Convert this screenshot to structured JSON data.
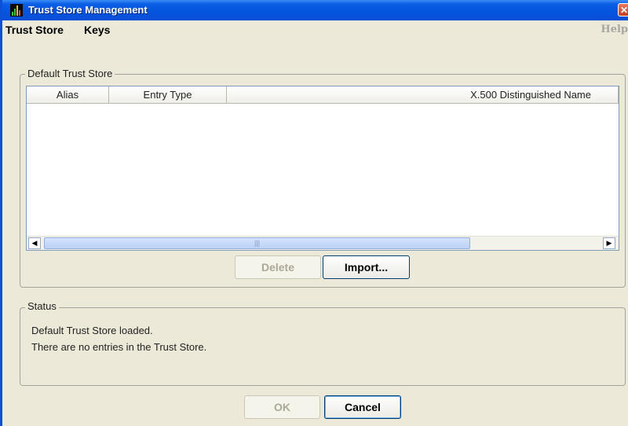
{
  "window": {
    "title": "Trust Store Management",
    "close_symbol": "✕"
  },
  "menubar": {
    "items": [
      "Trust Store",
      "Keys"
    ],
    "help": "Help"
  },
  "trust_store": {
    "group_title": "Default Trust Store",
    "columns": [
      "Alias",
      "Entry Type",
      "",
      "X.500 Distinguished Name"
    ],
    "rows": [],
    "scroll": {
      "left_arrow": "◀",
      "right_arrow": "▶",
      "thumb_grip": "|||"
    },
    "delete_label": "Delete",
    "import_label": "Import..."
  },
  "status": {
    "group_title": "Status",
    "lines": [
      "Default Trust Store loaded.",
      "There are no entries in the Trust Store."
    ]
  },
  "footer": {
    "ok_label": "OK",
    "cancel_label": "Cancel"
  },
  "colors": {
    "title_bar": "#0554e0",
    "window_bg": "#ece9d8",
    "close_button": "#d9542e"
  }
}
